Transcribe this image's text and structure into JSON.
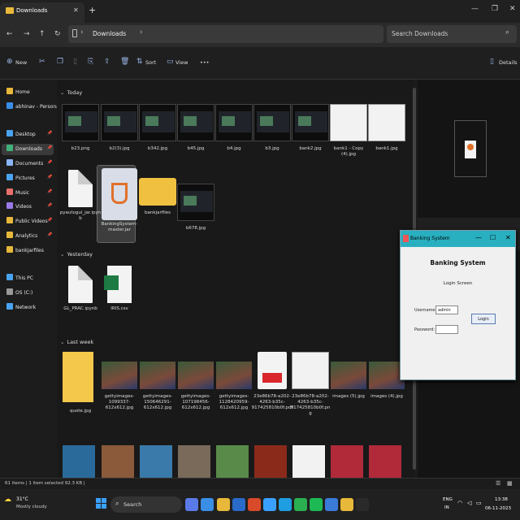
{
  "window": {
    "tab_title": "Downloads",
    "tab_close": "✕",
    "new_tab": "+"
  },
  "address": {
    "path": "Downloads",
    "search_placeholder": "Search Downloads"
  },
  "toolbar": {
    "new": "New",
    "sort": "Sort",
    "view": "View",
    "more": "•••",
    "details": "Details"
  },
  "sidebar": {
    "items": [
      {
        "label": "Home",
        "color": "#e8b83b"
      },
      {
        "label": "abhinav - Personal",
        "color": "#3a8ee6"
      },
      {
        "label": "Desktop",
        "color": "#4aa3f0"
      },
      {
        "label": "Downloads",
        "color": "#3fb07a"
      },
      {
        "label": "Documents",
        "color": "#8ab4f8"
      },
      {
        "label": "Pictures",
        "color": "#4aa3f0"
      },
      {
        "label": "Music",
        "color": "#e8706a"
      },
      {
        "label": "Videos",
        "color": "#9a7ae8"
      },
      {
        "label": "Public Videos",
        "color": "#e8b83b"
      },
      {
        "label": "Analytics",
        "color": "#e8b83b"
      },
      {
        "label": "bankjarfiles",
        "color": "#e8b83b"
      },
      {
        "label": "This PC",
        "color": "#4aa3f0"
      },
      {
        "label": "OS (C:)",
        "color": "#999999"
      },
      {
        "label": "Network",
        "color": "#4aa3f0"
      }
    ]
  },
  "sections": {
    "today": "Today",
    "yesterday": "Yesterday",
    "last_week": "Last week"
  },
  "files_today": [
    "b23.png",
    "b2(3).jpg",
    "b342.jpg",
    "b45.jpg",
    "b4.jpg",
    "b3.jpg",
    "bank2.jpg",
    "bank1 - Copy (4).jpg",
    "bank1.jpg",
    "pyautogui_jar.ipynb",
    "BankingSystem-master.jar",
    "bankjarfiles",
    "b678.jpg"
  ],
  "files_yesterday": [
    "GL_PRAC.ipynb",
    "IRIS.csv"
  ],
  "files_lastweek": [
    "quote.jpg",
    "gettyimages-1099337-612x612.jpg",
    "gettyimages-1506462​91-612x612.jpg",
    "gettyimages-1071984​56-612x612.jpg",
    "gettyimages-1128420959-612x612.jpg",
    "23e86b78-a202-4263-b35c-917425810b0f.pdf",
    "23e86b78-a202-4263-b35c-917425810b0f.png",
    "images (5).jpg",
    "images (4).jpg"
  ],
  "dialog": {
    "title": "Banking System",
    "heading": "Banking System",
    "subtitle": "Login Screen",
    "username_label": "Username:",
    "username_value": "admin",
    "password_label": "Password:",
    "login_button": "Login"
  },
  "status": {
    "text": "61 items  |  1 item selected  92.3 KB  |"
  },
  "taskbar": {
    "weather_temp": "31°C",
    "weather_desc": "Mostly cloudy",
    "search": "Search",
    "lang": "ENG",
    "region": "IN",
    "time": "13:38",
    "date": "06-11-2023"
  }
}
